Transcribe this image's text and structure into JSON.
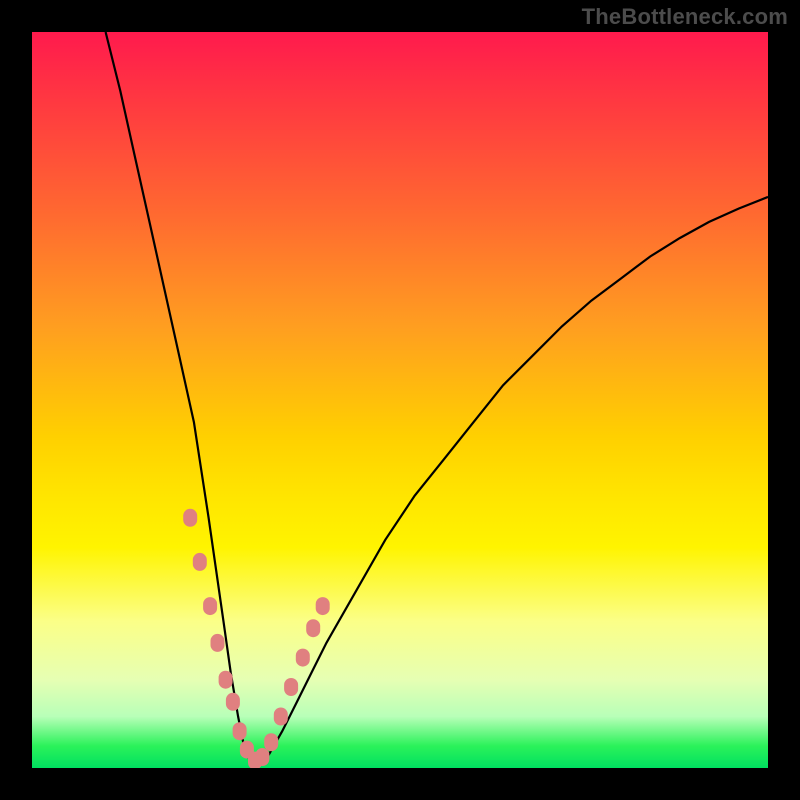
{
  "watermark": "TheBottleneck.com",
  "chart_data": {
    "type": "line",
    "title": "",
    "xlabel": "",
    "ylabel": "",
    "xlim": [
      0,
      100
    ],
    "ylim": [
      0,
      100
    ],
    "grid": false,
    "series": [
      {
        "name": "curve",
        "color": "#000000",
        "x": [
          10,
          12,
          14,
          16,
          18,
          20,
          22,
          24,
          25,
          26,
          27,
          28,
          29,
          30,
          31,
          32,
          34,
          36,
          38,
          40,
          44,
          48,
          52,
          56,
          60,
          64,
          68,
          72,
          76,
          80,
          84,
          88,
          92,
          96,
          100
        ],
        "values": [
          100,
          92,
          83,
          74,
          65,
          56,
          47,
          34,
          27,
          20,
          13,
          7,
          2,
          0.5,
          0.5,
          1.5,
          5,
          9,
          13,
          17,
          24,
          31,
          37,
          42,
          47,
          52,
          56,
          60,
          63.5,
          66.5,
          69.5,
          72,
          74.2,
          76,
          77.6
        ]
      }
    ],
    "markers": {
      "name": "dots",
      "color": "#e08080",
      "x": [
        21.5,
        22.8,
        24.2,
        25.2,
        26.3,
        27.3,
        28.2,
        29.2,
        30.3,
        31.3,
        32.5,
        33.8,
        35.2,
        36.8,
        38.2,
        39.5
      ],
      "values": [
        34,
        28,
        22,
        17,
        12,
        9,
        5,
        2.5,
        1,
        1.5,
        3.5,
        7,
        11,
        15,
        19,
        22
      ]
    },
    "gradient_stops": [
      {
        "pos": 0.0,
        "color": "#ff1a4d"
      },
      {
        "pos": 0.25,
        "color": "#ff6a30"
      },
      {
        "pos": 0.55,
        "color": "#ffd000"
      },
      {
        "pos": 0.8,
        "color": "#fbff87"
      },
      {
        "pos": 0.97,
        "color": "#2bf25a"
      },
      {
        "pos": 1.0,
        "color": "#00e060"
      }
    ]
  }
}
